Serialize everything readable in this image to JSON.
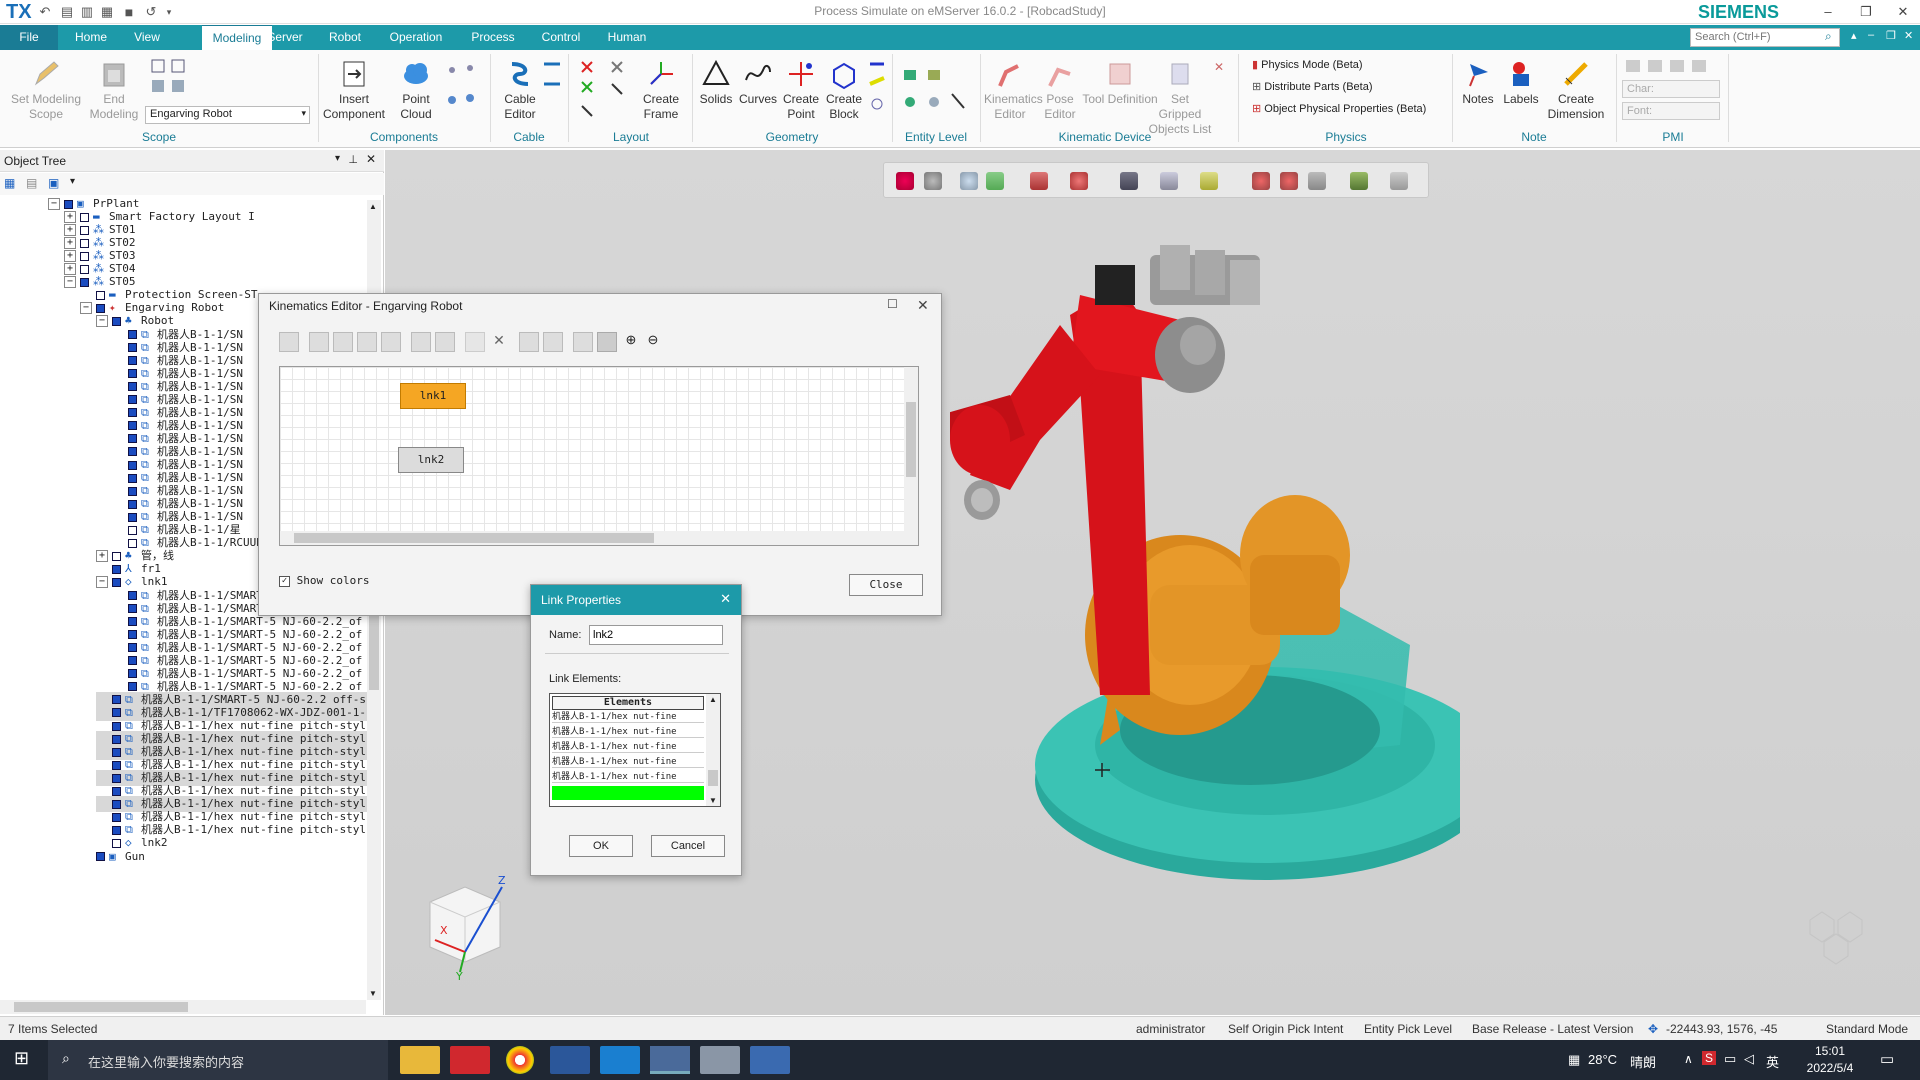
{
  "app": {
    "logo": "TX",
    "title": "Process Simulate on eMServer 16.0.2 - [RobcadStudy]",
    "brand": "SIEMENS",
    "search_placeholder": "Search (Ctrl+F)"
  },
  "menu": {
    "tabs": [
      "File",
      "Home",
      "View",
      "Modeling",
      "Server",
      "Robot",
      "Operation",
      "Process",
      "Control",
      "Human"
    ],
    "active": "Modeling"
  },
  "ribbon": {
    "scope": {
      "set_modeling_scope": "Set Modeling Scope",
      "end_modeling": "End Modeling",
      "dropdown_value": "Engarving Robot",
      "label": "Scope"
    },
    "components": {
      "insert_component": "Insert Component",
      "point_cloud": "Point Cloud",
      "label": "Components"
    },
    "cable": {
      "cable_editor": "Cable Editor",
      "label": "Cable"
    },
    "layout": {
      "create_frame": "Create Frame",
      "label": "Layout"
    },
    "geometry": {
      "solids": "Solids",
      "curves": "Curves",
      "create_point": "Create Point",
      "create_block": "Create Block",
      "label": "Geometry"
    },
    "entity_level": {
      "label": "Entity Level"
    },
    "kinematic": {
      "kinematics_editor": "Kinematics Editor",
      "pose_editor": "Pose Editor",
      "tool_definition": "Tool Definition",
      "set_gripped": "Set Gripped Objects List",
      "label": "Kinematic Device"
    },
    "physics": {
      "physics_mode": "Physics Mode (Beta)",
      "distribute_parts": "Distribute Parts (Beta)",
      "object_physical": "Object Physical Properties (Beta)",
      "label": "Physics"
    },
    "note": {
      "notes": "Notes",
      "labels": "Labels",
      "create_dimension": "Create Dimension",
      "label": "Note"
    },
    "pmi": {
      "char": "Char:",
      "font": "Font:",
      "label": "PMI"
    }
  },
  "object_tree": {
    "title": "Object Tree",
    "rows": [
      {
        "text": "PrPlant",
        "level": 0,
        "expander": "-",
        "icon": "plant"
      },
      {
        "text": "Smart Factory Layout I",
        "level": 1,
        "expander": "+",
        "icon": "layout",
        "unchecked": true
      },
      {
        "text": "ST01",
        "level": 1,
        "expander": "+",
        "icon": "station",
        "unchecked": true
      },
      {
        "text": "ST02",
        "level": 1,
        "expander": "+",
        "icon": "station",
        "unchecked": true
      },
      {
        "text": "ST03",
        "level": 1,
        "expander": "+",
        "icon": "station",
        "unchecked": true
      },
      {
        "text": "ST04",
        "level": 1,
        "expander": "+",
        "icon": "station",
        "unchecked": true
      },
      {
        "text": "ST05",
        "level": 1,
        "expander": "-",
        "icon": "station"
      },
      {
        "text": "Protection Screen-ST",
        "level": 2,
        "expander": "",
        "icon": "screen",
        "unchecked": true
      },
      {
        "text": "Engarving Robot",
        "level": 2,
        "expander": "-",
        "icon": "robot"
      },
      {
        "text": "Robot",
        "level": 3,
        "expander": "-",
        "icon": "link"
      },
      {
        "text": "机器人B-1-1/SN",
        "level": 4,
        "expander": "",
        "icon": "part"
      },
      {
        "text": "机器人B-1-1/SN",
        "level": 4,
        "expander": "",
        "icon": "part"
      },
      {
        "text": "机器人B-1-1/SN",
        "level": 4,
        "expander": "",
        "icon": "part"
      },
      {
        "text": "机器人B-1-1/SN",
        "level": 4,
        "expander": "",
        "icon": "part"
      },
      {
        "text": "机器人B-1-1/SN",
        "level": 4,
        "expander": "",
        "icon": "part"
      },
      {
        "text": "机器人B-1-1/SN",
        "level": 4,
        "expander": "",
        "icon": "part"
      },
      {
        "text": "机器人B-1-1/SN",
        "level": 4,
        "expander": "",
        "icon": "part"
      },
      {
        "text": "机器人B-1-1/SN",
        "level": 4,
        "expander": "",
        "icon": "part"
      },
      {
        "text": "机器人B-1-1/SN",
        "level": 4,
        "expander": "",
        "icon": "part"
      },
      {
        "text": "机器人B-1-1/SN",
        "level": 4,
        "expander": "",
        "icon": "part"
      },
      {
        "text": "机器人B-1-1/SN",
        "level": 4,
        "expander": "",
        "icon": "part"
      },
      {
        "text": "机器人B-1-1/SN",
        "level": 4,
        "expander": "",
        "icon": "part"
      },
      {
        "text": "机器人B-1-1/SN",
        "level": 4,
        "expander": "",
        "icon": "part"
      },
      {
        "text": "机器人B-1-1/SN",
        "level": 4,
        "expander": "",
        "icon": "part"
      },
      {
        "text": "机器人B-1-1/SN",
        "level": 4,
        "expander": "",
        "icon": "part"
      },
      {
        "text": "机器人B-1-1/星",
        "level": 4,
        "expander": "",
        "icon": "part",
        "unchecked": true
      },
      {
        "text": "机器人B-1-1/RCUUB_52K_2_14a-1-sc",
        "level": 4,
        "expander": "",
        "icon": "part",
        "unchecked": true
      },
      {
        "text": "管，线",
        "level": 3,
        "expander": "+",
        "icon": "link",
        "unchecked": true
      },
      {
        "text": "fr1",
        "level": 3,
        "expander": "",
        "icon": "frame"
      },
      {
        "text": "lnk1",
        "level": 3,
        "expander": "-",
        "icon": "lnk"
      },
      {
        "text": "机器人B-1-1/SMART-5 NJ-60-2.2_of",
        "level": 4,
        "expander": "",
        "icon": "part"
      },
      {
        "text": "机器人B-1-1/SMART-5 NJ-60-2.2_of",
        "level": 4,
        "expander": "",
        "icon": "part"
      },
      {
        "text": "机器人B-1-1/SMART-5 NJ-60-2.2_of",
        "level": 4,
        "expander": "",
        "icon": "part"
      },
      {
        "text": "机器人B-1-1/SMART-5 NJ-60-2.2_of",
        "level": 4,
        "expander": "",
        "icon": "part"
      },
      {
        "text": "机器人B-1-1/SMART-5 NJ-60-2.2_of",
        "level": 4,
        "expander": "",
        "icon": "part"
      },
      {
        "text": "机器人B-1-1/SMART-5 NJ-60-2.2_of",
        "level": 4,
        "expander": "",
        "icon": "part"
      },
      {
        "text": "机器人B-1-1/SMART-5 NJ-60-2.2_of",
        "level": 4,
        "expander": "",
        "icon": "part"
      },
      {
        "text": "机器人B-1-1/SMART-5 NJ-60-2.2_of",
        "level": 4,
        "expander": "",
        "icon": "part"
      },
      {
        "text": "机器人B-1-1/SMART-5 NJ-60-2.2_off-s",
        "level": 3,
        "expander": "",
        "icon": "part",
        "selected": true
      },
      {
        "text": "机器人B-1-1/TF1708062-WX-JDZ-001-1-",
        "level": 3,
        "expander": "",
        "icon": "part",
        "selected": true
      },
      {
        "text": "机器人B-1-1/hex nut-fine pitch-styl",
        "level": 3,
        "expander": "",
        "icon": "part"
      },
      {
        "text": "机器人B-1-1/hex nut-fine pitch-styl",
        "level": 3,
        "expander": "",
        "icon": "part",
        "selected": true
      },
      {
        "text": "机器人B-1-1/hex nut-fine pitch-styl",
        "level": 3,
        "expander": "",
        "icon": "part",
        "selected": true
      },
      {
        "text": "机器人B-1-1/hex nut-fine pitch-styl",
        "level": 3,
        "expander": "",
        "icon": "part"
      },
      {
        "text": "机器人B-1-1/hex nut-fine pitch-styl",
        "level": 3,
        "expander": "",
        "icon": "part",
        "selected": true
      },
      {
        "text": "机器人B-1-1/hex nut-fine pitch-styl",
        "level": 3,
        "expander": "",
        "icon": "part"
      },
      {
        "text": "机器人B-1-1/hex nut-fine pitch-styl",
        "level": 3,
        "expander": "",
        "icon": "part",
        "selected": true
      },
      {
        "text": "机器人B-1-1/hex nut-fine pitch-styl",
        "level": 3,
        "expander": "",
        "icon": "part"
      },
      {
        "text": "机器人B-1-1/hex nut-fine pitch-styl",
        "level": 3,
        "expander": "",
        "icon": "part"
      },
      {
        "text": "lnk2",
        "level": 3,
        "expander": "",
        "icon": "lnk",
        "unchecked": true
      },
      {
        "text": "Gun",
        "level": 2,
        "expander": "",
        "icon": "gun"
      }
    ]
  },
  "kinematics_editor": {
    "title": "Kinematics Editor -  Engarving Robot",
    "links": [
      "lnk1",
      "lnk2"
    ],
    "show_colors": "Show colors",
    "close": "Close"
  },
  "link_properties": {
    "title": "Link Properties",
    "name_label": "Name:",
    "name_value": "lnk2",
    "elements_label": "Link Elements:",
    "elements_header": "Elements",
    "elements": [
      "机器人B-1-1/hex nut-fine",
      "机器人B-1-1/hex nut-fine",
      "机器人B-1-1/hex nut-fine",
      "机器人B-1-1/hex nut-fine",
      "机器人B-1-1/hex nut-fine"
    ],
    "ok": "OK",
    "cancel": "Cancel"
  },
  "status": {
    "selected": "7 Items Selected",
    "user": "administrator",
    "pick_intent": "Self Origin Pick Intent",
    "pick_level": "Entity Pick Level",
    "release": "Base Release - Latest Version",
    "coords": "-22443.93, 1576, -45",
    "mode": "Standard Mode"
  },
  "taskbar": {
    "search_placeholder": "在这里输入你要搜索的内容",
    "temperature": "28°C",
    "weather": "晴朗",
    "ime": "英",
    "time": "15:01",
    "date": "2022/5/4"
  },
  "colors": {
    "accent": "#1d9aa9",
    "robot_red": "#d6121a",
    "robot_orange": "#e39527",
    "base_teal": "#35c1b3",
    "selected_link": "#f5a623",
    "element_highlight": "#00ff00"
  }
}
